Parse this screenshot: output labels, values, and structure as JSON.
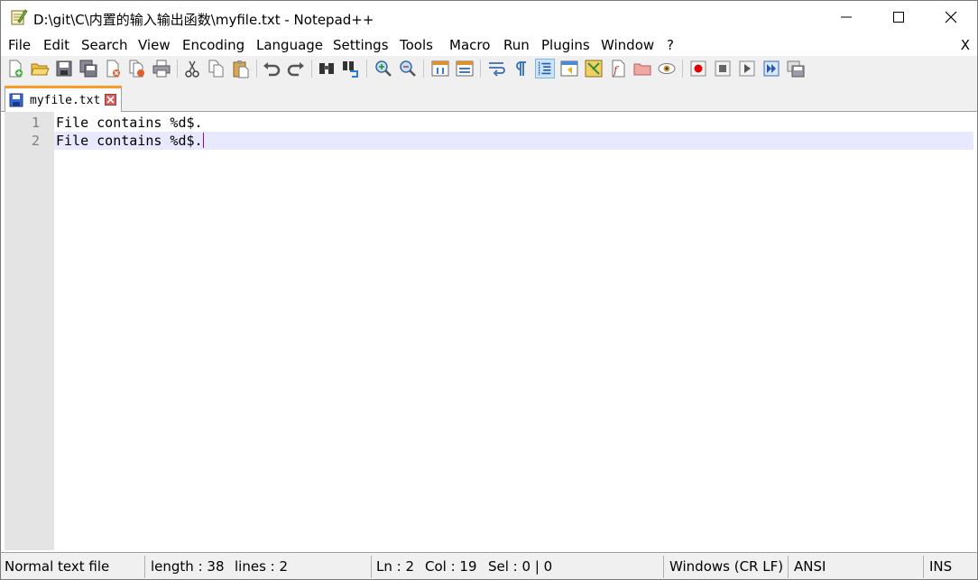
{
  "window": {
    "title": "D:\\git\\C\\内置的输入输出函数\\myfile.txt - Notepad++"
  },
  "menubar": {
    "items": [
      "File",
      "Edit",
      "Search",
      "View",
      "Encoding",
      "Language",
      "Settings",
      "Tools",
      "Macro",
      "Run",
      "Plugins",
      "Window",
      "?"
    ],
    "close_doc": "X"
  },
  "toolbar": {
    "icons": [
      "new-file-icon",
      "open-file-icon",
      "save-icon",
      "save-all-icon",
      "close-icon",
      "close-all-icon",
      "print-icon",
      "cut-icon",
      "copy-icon",
      "paste-icon",
      "undo-icon",
      "redo-icon",
      "find-icon",
      "replace-icon",
      "zoom-in-icon",
      "zoom-out-icon",
      "sync-vertical-icon",
      "sync-horizontal-icon",
      "word-wrap-icon",
      "show-all-chars-icon",
      "indent-guide-icon",
      "udl-icon",
      "doc-map-icon",
      "function-list-icon",
      "folder-workspace-icon",
      "monitoring-icon",
      "record-macro-icon",
      "stop-macro-icon",
      "play-macro-icon",
      "run-macro-multiple-icon",
      "save-macro-icon"
    ]
  },
  "tabs": [
    {
      "label": "myfile.txt"
    }
  ],
  "editor": {
    "lines": [
      {
        "num": "1",
        "text": "File contains %d$."
      },
      {
        "num": "2",
        "text": "File contains %d$."
      }
    ],
    "current_line": 2
  },
  "statusbar": {
    "file_type": "Normal text file",
    "length": "length : 38",
    "lines": "lines : 2",
    "ln": "Ln : 2",
    "col": "Col : 19",
    "sel": "Sel : 0 | 0",
    "eol": "Windows (CR LF)",
    "encoding": "ANSI",
    "mode": "INS"
  },
  "colors": {
    "tab_accent": "#fa9a28",
    "current_line_bg": "#e8e8ff",
    "caret": "#8000ff",
    "record_red": "#e00000"
  }
}
